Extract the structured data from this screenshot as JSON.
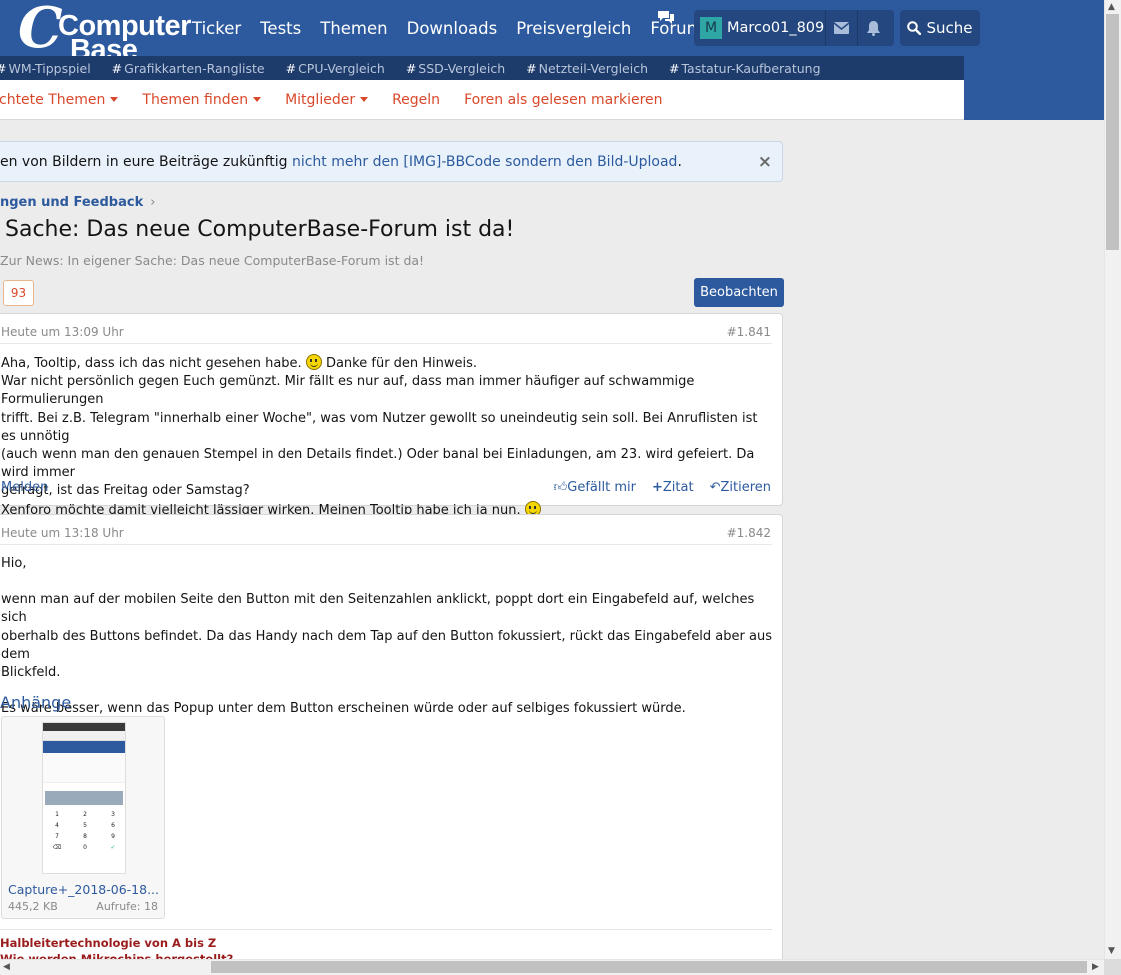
{
  "header": {
    "logo": {
      "line1": "Computer",
      "line2": "Base"
    },
    "nav": [
      "Ticker",
      "Tests",
      "Themen",
      "Downloads",
      "Preisvergleich",
      "Forum"
    ],
    "avatar_letter": "M",
    "username": "Marco01_809",
    "search_label": "Suche"
  },
  "tags": [
    "WM-Tippspiel",
    "Grafikkarten-Rangliste",
    "CPU-Vergleich",
    "SSD-Vergleich",
    "Netzteil-Vergleich",
    "Tastatur-Kaufberatung"
  ],
  "subnav": {
    "watched": "chtete Themen",
    "find": "Themen finden",
    "members": "Mitglieder",
    "rules": "Regeln",
    "mark_read": "Foren als gelesen markieren"
  },
  "notice": {
    "text": "en von Bildern in eure Beiträge zukünftig ",
    "link": "nicht mehr den [IMG]-BBCode sondern den Bild-Upload",
    "end": ".",
    "close": "×"
  },
  "breadcrumb": "ngen und Feedback",
  "thread": {
    "title": "Sache: Das neue ComputerBase-Forum ist da!",
    "subtitle": "Zur News: In eigener Sache: Das neue ComputerBase-Forum ist da!",
    "page": "93",
    "watch_label": "Beobachten"
  },
  "posts": [
    {
      "time": "Heute um 13:09 Uhr",
      "num": "#1.841",
      "lines": [
        "Aha, Tooltip, dass ich das nicht gesehen habe.",
        " Danke für den Hinweis.",
        "War nicht persönlich gegen Euch gemünzt. Mir fällt es nur auf, dass man immer häufiger auf schwammige Formulierungen",
        "trifft. Bei z.B. Telegram \"innerhalb einer Woche\", was vom Nutzer gewollt so uneindeutig sein soll. Bei Anruflisten ist es unnötig",
        "(auch wenn man den genauen Stempel in den Details findet.) Oder banal bei Einladungen, am 23. wird gefeiert. Da wird immer",
        "gefragt, ist das Freitag oder Samstag?",
        "Xenforo möchte damit vielleicht lässiger wirken. Meinen Tooltip habe ich ja nun. "
      ],
      "report": "Melden",
      "like": "Gefällt mir",
      "quote_plus": "Zitat",
      "quote": "Zitieren"
    },
    {
      "time": "Heute um 13:18 Uhr",
      "num": "#1.842",
      "greeting": "Hio,",
      "p1": [
        "wenn man auf der mobilen Seite den Button mit den Seitenzahlen anklickt, poppt dort ein Eingabefeld auf, welches sich",
        "oberhalb des Buttons befindet. Da das Handy nach dem Tap auf den Button fokussiert, rückt das Eingabefeld aber aus dem",
        "Blickfeld."
      ],
      "p2": "Es wäre besser, wenn das Popup unter dem Button erscheinen würde oder auf selbiges fokussiert würde.",
      "attachments_title": "Anhänge",
      "attachment": {
        "name": "Capture+_2018-06-18...",
        "size": "445,2 KB",
        "views": "Aufrufe: 18"
      },
      "signature": [
        "Halbleitertechnologie von A bis Z",
        "Wie werden Mikrochips hergestellt?"
      ]
    }
  ]
}
